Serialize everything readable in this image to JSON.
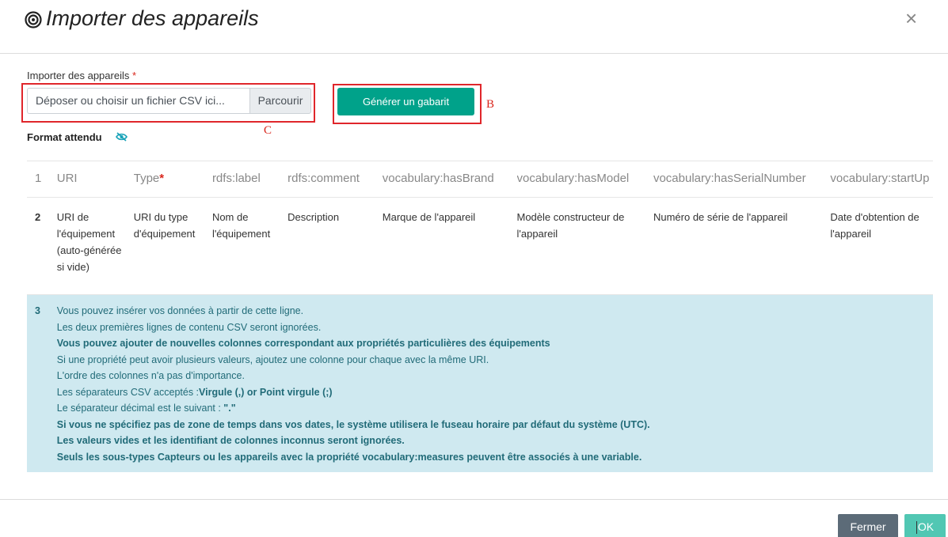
{
  "modal": {
    "title": "Importer des appareils",
    "close_symbol": "×"
  },
  "field": {
    "label": "Importer des appareils",
    "required_mark": "*",
    "placeholder": "Déposer ou choisir un fichier CSV ici...",
    "browse_label": "Parcourir"
  },
  "generate_button": "Générer un gabarit",
  "annotations": {
    "b": "B",
    "c": "C"
  },
  "format": {
    "label": "Format attendu",
    "icon": "eye-slash-icon"
  },
  "table": {
    "header_row_number": "1",
    "columns": [
      {
        "name": "URI",
        "required": ""
      },
      {
        "name": "Type",
        "required": "*"
      },
      {
        "name": "rdfs:label",
        "required": ""
      },
      {
        "name": "rdfs:comment",
        "required": ""
      },
      {
        "name": "vocabulary:hasBrand",
        "required": ""
      },
      {
        "name": "vocabulary:hasModel",
        "required": ""
      },
      {
        "name": "vocabulary:hasSerialNumber",
        "required": ""
      },
      {
        "name": "vocabulary:startUp",
        "required": ""
      }
    ],
    "description_row_number": "2",
    "descriptions": [
      "URI de l'équipement (auto-générée si vide)",
      "URI du type d'équipement",
      "Nom de l'équipement",
      "Description",
      "Marque de l'appareil",
      "Modèle constructeur de l'appareil",
      "Numéro de série de l'appareil",
      "Date d'obtention de l'appareil"
    ],
    "hint_row_number": "3",
    "hints": {
      "l1": "Vous pouvez insérer vos données à partir de cette ligne.",
      "l2": "Les deux premières lignes de contenu CSV seront ignorées.",
      "l3": "Vous pouvez ajouter de nouvelles colonnes correspondant aux propriétés particulières des équipements",
      "l4": "Si une propriété peut avoir plusieurs valeurs, ajoutez une colonne pour chaque avec la même URI.",
      "l5": "L'ordre des colonnes n'a pas d'importance.",
      "l6_prefix": "Les séparateurs CSV acceptés :",
      "l6_bold": "Virgule (,) or Point virgule (;)",
      "l7_prefix": "Le séparateur décimal est le suivant : ",
      "l7_bold": "\".\"",
      "l8": "Si vous ne spécifiez pas de zone de temps dans vos dates, le système utilisera le fuseau horaire par défaut du système (UTC).",
      "l9": "Les valeurs vides et les identifiant de colonnes inconnus seront ignorées.",
      "l10": "Seuls les sous-types Capteurs ou les appareils avec la propriété vocabulary:measures peuvent être associés à une variable."
    }
  },
  "footer": {
    "close_label": "Fermer",
    "ok_label": "OK"
  }
}
